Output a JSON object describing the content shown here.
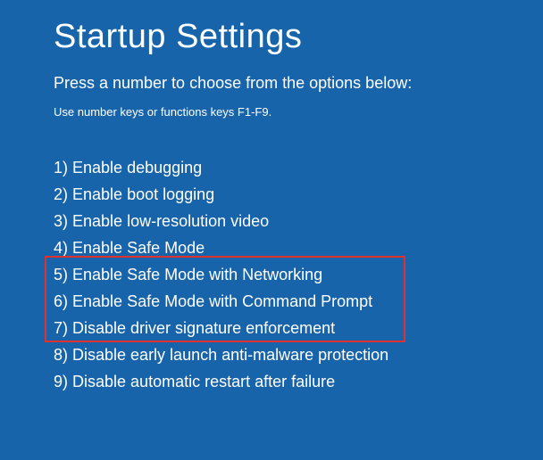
{
  "title": "Startup Settings",
  "subtitle": "Press a number to choose from the options below:",
  "hint": "Use number keys or functions keys F1-F9.",
  "options": [
    {
      "num": "1",
      "label": "Enable debugging"
    },
    {
      "num": "2",
      "label": "Enable boot logging"
    },
    {
      "num": "3",
      "label": "Enable low-resolution video"
    },
    {
      "num": "4",
      "label": "Enable Safe Mode"
    },
    {
      "num": "5",
      "label": "Enable Safe Mode with Networking"
    },
    {
      "num": "6",
      "label": "Enable Safe Mode with Command Prompt"
    },
    {
      "num": "7",
      "label": "Disable driver signature enforcement"
    },
    {
      "num": "8",
      "label": "Disable early launch anti-malware protection"
    },
    {
      "num": "9",
      "label": "Disable automatic restart after failure"
    }
  ],
  "highlight": {
    "start": 3,
    "end": 5
  },
  "colors": {
    "background": "#1864ab",
    "text": "#ffffff",
    "highlight_border": "#e03131"
  }
}
